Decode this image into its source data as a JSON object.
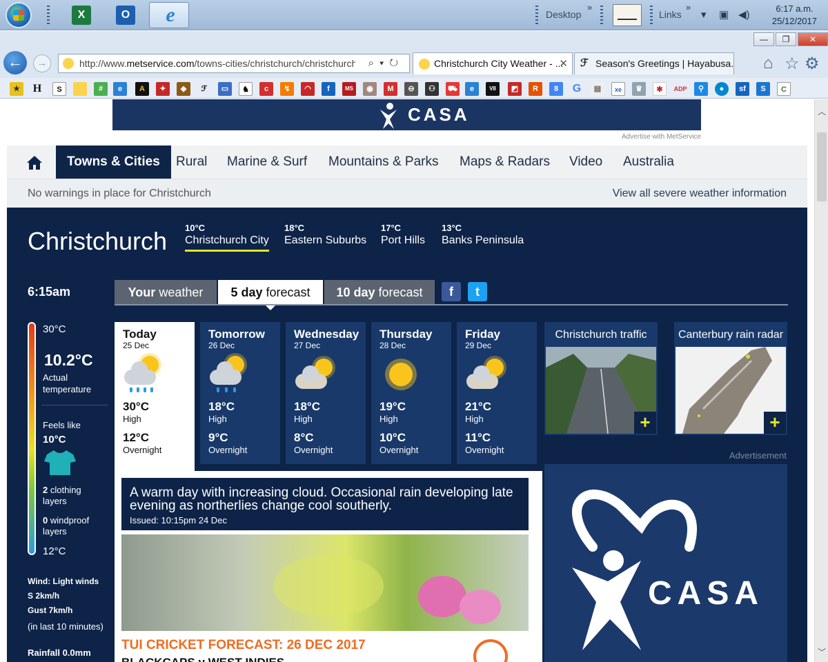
{
  "taskbar": {
    "links_labels": [
      "Desktop",
      "Links"
    ],
    "clock_time": "6:17 a.m.",
    "clock_date": "25/12/2017",
    "apps": [
      "excel-icon",
      "outlook-icon",
      "internet-explorer-icon"
    ]
  },
  "browser": {
    "url_prefix": "http://www.",
    "url_domain": "metservice.com",
    "url_rest": "/towns-cities/christchurch/christchurch",
    "tabs": [
      {
        "title": "Christchurch City Weather - ...",
        "active": true
      },
      {
        "title": "Season's Greetings | Hayabusa...",
        "active": false
      }
    ]
  },
  "page": {
    "advertise": "Advertise with MetService",
    "ad_brand": "CASA",
    "nav": [
      "Towns & Cities",
      "Rural",
      "Marine & Surf",
      "Mountains & Parks",
      "Maps & Radars",
      "Video",
      "Australia"
    ],
    "warning": "No warnings in place for Christchurch",
    "warning_link": "View all severe weather information",
    "city": "Christchurch",
    "subs": [
      {
        "temp": "10°C",
        "name": "Christchurch City"
      },
      {
        "temp": "18°C",
        "name": "Eastern Suburbs"
      },
      {
        "temp": "17°C",
        "name": "Port Hills"
      },
      {
        "temp": "13°C",
        "name": "Banks Peninsula"
      }
    ],
    "time": "6:15am",
    "tabs": [
      {
        "bold": "Your",
        "rest": " weather"
      },
      {
        "bold": "5 day",
        "rest": " forecast"
      },
      {
        "bold": "10 day",
        "rest": " forecast"
      }
    ],
    "gauge": {
      "max": "30°C",
      "actual": "10.2°C",
      "actual_label_1": "Actual",
      "actual_label_2": "temperature",
      "feels_label": "Feels like",
      "feels": "10°C",
      "clothing_n": "2",
      "clothing_1": " clothing",
      "clothing_2": "layers",
      "windproof_n": "0",
      "windproof_1": " windproof",
      "windproof_2": "layers",
      "min": "12°C",
      "wind": "Wind: Light winds",
      "wind_s": "S 2km/h",
      "gust": "Gust 7km/h",
      "wind_note": "(in last 10 minutes)",
      "rain": "Rainfall 0.0mm"
    },
    "days": [
      {
        "day": "Today",
        "date": "25 Dec",
        "icon": "sun-cloud-rain-icon",
        "hi": "30°C",
        "hi_l": "High",
        "lo": "12°C",
        "lo_l": "Overnight"
      },
      {
        "day": "Tomorrow",
        "date": "26 Dec",
        "icon": "sun-cloud-rain-icon",
        "hi": "18°C",
        "hi_l": "High",
        "lo": "9°C",
        "lo_l": "Overnight"
      },
      {
        "day": "Wednesday",
        "date": "27 Dec",
        "icon": "partly-cloudy-icon",
        "hi": "18°C",
        "hi_l": "High",
        "lo": "8°C",
        "lo_l": "Overnight"
      },
      {
        "day": "Thursday",
        "date": "28 Dec",
        "icon": "sunny-icon",
        "hi": "19°C",
        "hi_l": "High",
        "lo": "10°C",
        "lo_l": "Overnight"
      },
      {
        "day": "Friday",
        "date": "29 Dec",
        "icon": "partly-cloudy-icon",
        "hi": "21°C",
        "hi_l": "High",
        "lo": "11°C",
        "lo_l": "Overnight"
      }
    ],
    "tiles": [
      "Christchurch traffic",
      "Canterbury rain radar"
    ],
    "forecast_text": "A warm day with increasing cloud. Occasional rain developing late evening as northerlies change cool southerly.",
    "issued": "Issued: 10:15pm 24 Dec",
    "cricket_title": "TUI CRICKET FORECAST: 26 DEC 2017",
    "cricket_sub": "BLACKCAPS v WEST INDIES",
    "advertisement": "Advertisement",
    "colors": {
      "navy": "#0d2348",
      "card": "#18396a",
      "accent": "#e6e626",
      "orange": "#f26b21"
    }
  }
}
